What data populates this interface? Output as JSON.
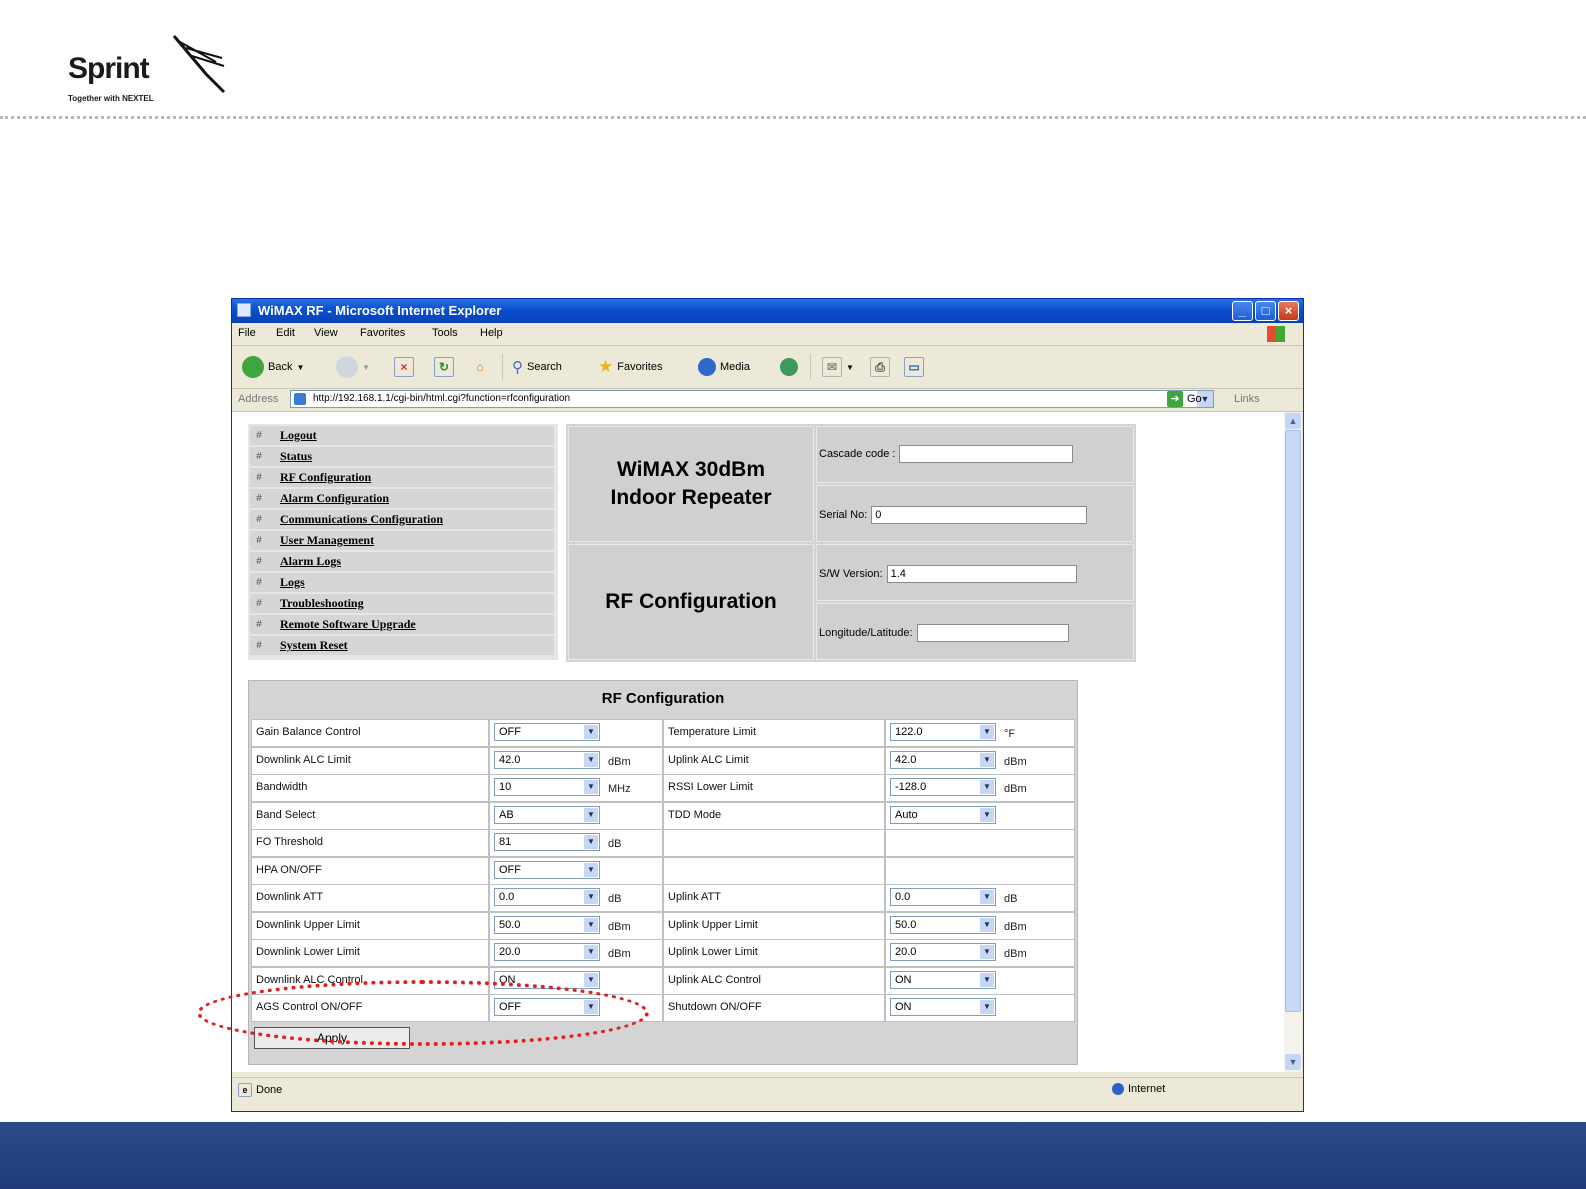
{
  "slide": {
    "logo_word": "Sprint",
    "logo_tagline": "Together with NEXTEL",
    "colors": {
      "footer_band": "#1f3c78",
      "highlight": "#e02020"
    }
  },
  "window": {
    "title": "WiMAX RF - Microsoft Internet Explorer",
    "controls": {
      "minimize": "_",
      "maximize": "□",
      "close": "×"
    }
  },
  "menubar": [
    "File",
    "Edit",
    "View",
    "Favorites",
    "Tools",
    "Help"
  ],
  "toolbar": {
    "back": "Back",
    "search": "Search",
    "favorites": "Favorites",
    "media": "Media"
  },
  "address": {
    "label": "Address",
    "url": "http://192.168.1.1/cgi-bin/html.cgi?function=rfconfiguration",
    "go": "Go",
    "links": "Links"
  },
  "nav": {
    "bullet": "#",
    "items": [
      "Logout",
      "Status",
      "RF Configuration",
      "Alarm Configuration",
      "Communications Configuration",
      "User Management",
      "Alarm Logs",
      "Logs",
      "Troubleshooting",
      "Remote Software Upgrade",
      "System Reset"
    ]
  },
  "header": {
    "device_title_line1": "WiMAX 30dBm",
    "device_title_line2": "Indoor Repeater",
    "page_title": "RF Configuration",
    "fields": [
      {
        "label": "Cascade code :",
        "value": ""
      },
      {
        "label": "Serial No:",
        "value": "0"
      },
      {
        "label": "S/W Version:",
        "value": "1.4"
      },
      {
        "label": "Longitude/Latitude:",
        "value": ""
      }
    ]
  },
  "rf": {
    "title": "RF Configuration",
    "rows": [
      {
        "l_label": "Gain Balance Control",
        "l_value": "OFF",
        "l_unit": "",
        "r_label": "Temperature Limit",
        "r_value": "122.0",
        "r_unit": "°F"
      },
      {
        "l_label": "Downlink ALC Limit",
        "l_value": "42.0",
        "l_unit": "dBm",
        "r_label": "Uplink ALC Limit",
        "r_value": "42.0",
        "r_unit": "dBm"
      },
      {
        "l_label": "Bandwidth",
        "l_value": "10",
        "l_unit": "MHz",
        "r_label": "RSSI Lower Limit",
        "r_value": "-128.0",
        "r_unit": "dBm"
      },
      {
        "l_label": "Band Select",
        "l_value": "AB",
        "l_unit": "",
        "r_label": "TDD Mode",
        "r_value": "Auto",
        "r_unit": ""
      },
      {
        "l_label": "FO Threshold",
        "l_value": "81",
        "l_unit": "dB",
        "r_label": "",
        "r_value": "",
        "r_unit": ""
      },
      {
        "l_label": "HPA ON/OFF",
        "l_value": "OFF",
        "l_unit": "",
        "r_label": "",
        "r_value": "",
        "r_unit": ""
      },
      {
        "l_label": "Downlink ATT",
        "l_value": "0.0",
        "l_unit": "dB",
        "r_label": "Uplink ATT",
        "r_value": "0.0",
        "r_unit": "dB"
      },
      {
        "l_label": "Downlink Upper Limit",
        "l_value": "50.0",
        "l_unit": "dBm",
        "r_label": "Uplink Upper Limit",
        "r_value": "50.0",
        "r_unit": "dBm"
      },
      {
        "l_label": "Downlink Lower Limit",
        "l_value": "20.0",
        "l_unit": "dBm",
        "r_label": "Uplink Lower Limit",
        "r_value": "20.0",
        "r_unit": "dBm"
      },
      {
        "l_label": "Downlink ALC Control",
        "l_value": "ON",
        "l_unit": "",
        "r_label": "Uplink ALC Control",
        "r_value": "ON",
        "r_unit": ""
      },
      {
        "l_label": "AGS Control ON/OFF",
        "l_value": "OFF",
        "l_unit": "",
        "r_label": "Shutdown ON/OFF",
        "r_value": "ON",
        "r_unit": ""
      }
    ],
    "apply": "Apply"
  },
  "statusbar": {
    "left": "Done",
    "zone": "Internet"
  }
}
